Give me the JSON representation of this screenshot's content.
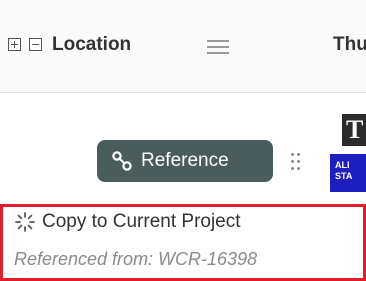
{
  "header": {
    "expand_icon": "plus-box-icon",
    "collapse_icon": "minus-box-icon",
    "column_location": "Location",
    "filter_icon": "filter-menu-icon",
    "column_next_partial": "Thu"
  },
  "row": {
    "reference_button": {
      "icon": "link-icon",
      "label": "Reference",
      "color": "#4a5d5c"
    },
    "drag_icon": "drag-handle-icon",
    "logo": {
      "top_letter": "T",
      "bottom_text_line1": "ALI",
      "bottom_text_line2": "STA"
    }
  },
  "dropdown": {
    "highlight_color": "#e01e2b",
    "copy_action": {
      "icon": "loading-spinner-icon",
      "label": "Copy to Current Project"
    },
    "referenced_from": "Referenced from: WCR-16398"
  }
}
